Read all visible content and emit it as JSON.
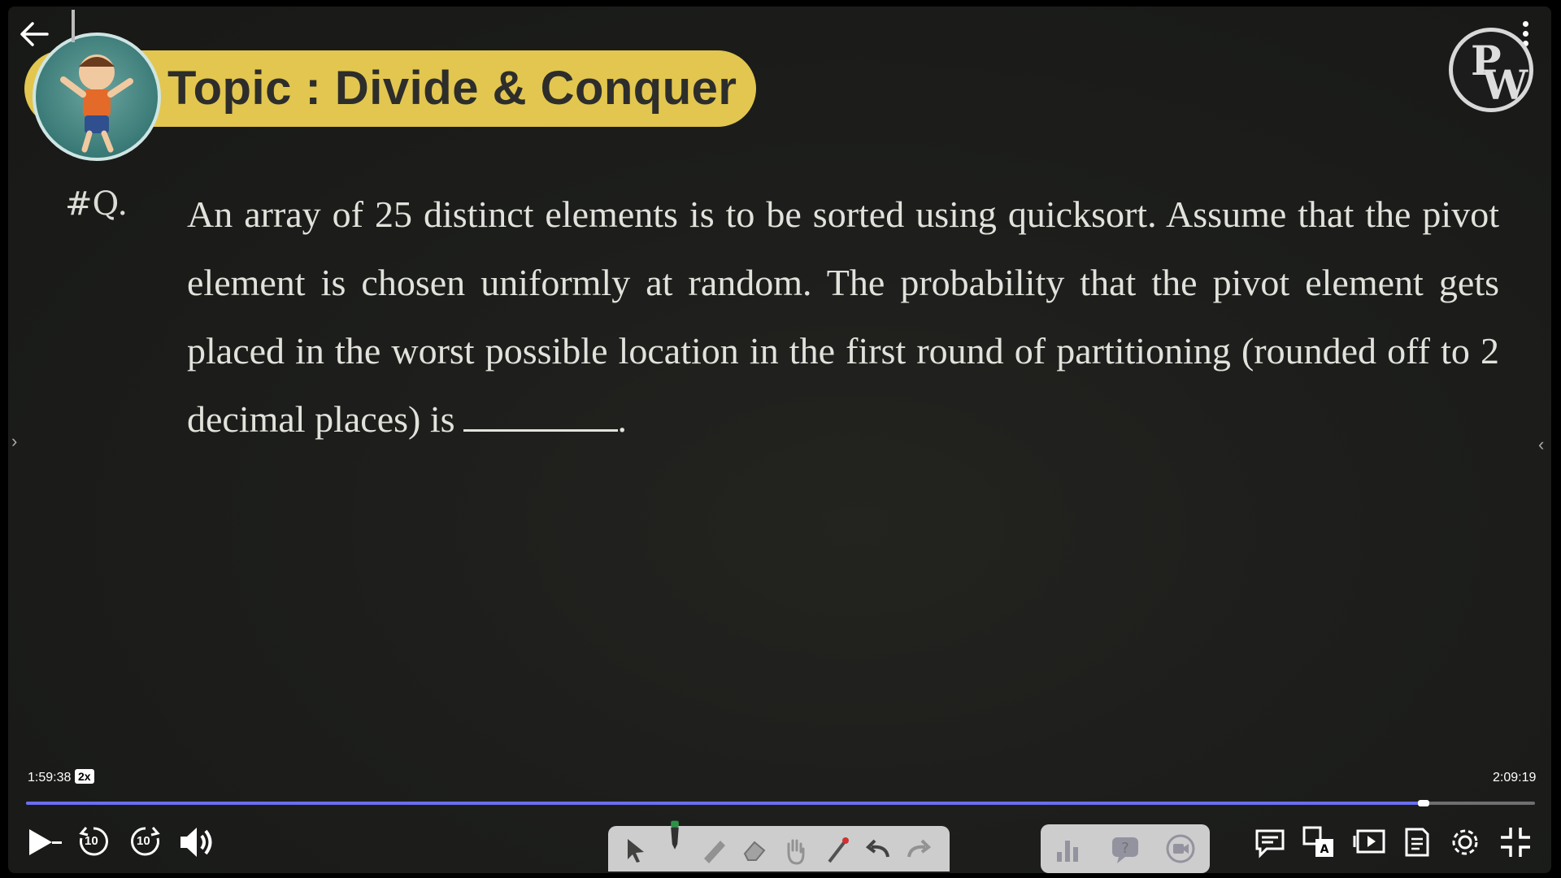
{
  "lecture": {
    "topic": "Topic : Divide & Conquer",
    "question_label": "#Q.",
    "question_text": "An array of 25 distinct elements is to be sorted using quicksort. Assume that the pivot element is chosen uniformly at random. The probability that the pivot element gets placed in the worst possible location in the first round of partitioning (rounded off to 2 decimal places) is",
    "question_end": "."
  },
  "logo": {
    "top": "P",
    "bottom": "W"
  },
  "player": {
    "current_time": "1:59:38",
    "speed": "2x",
    "duration": "2:09:19",
    "progress_fraction": 0.926,
    "skip_back_seconds": "10",
    "skip_forward_seconds": "10",
    "accent": "#6a6ff0"
  },
  "side_tabs": {
    "left": "›",
    "right": "‹"
  },
  "colors": {
    "banner": "#e2c64f",
    "board": "#1d1e1c",
    "text": "#e2e2dc"
  }
}
